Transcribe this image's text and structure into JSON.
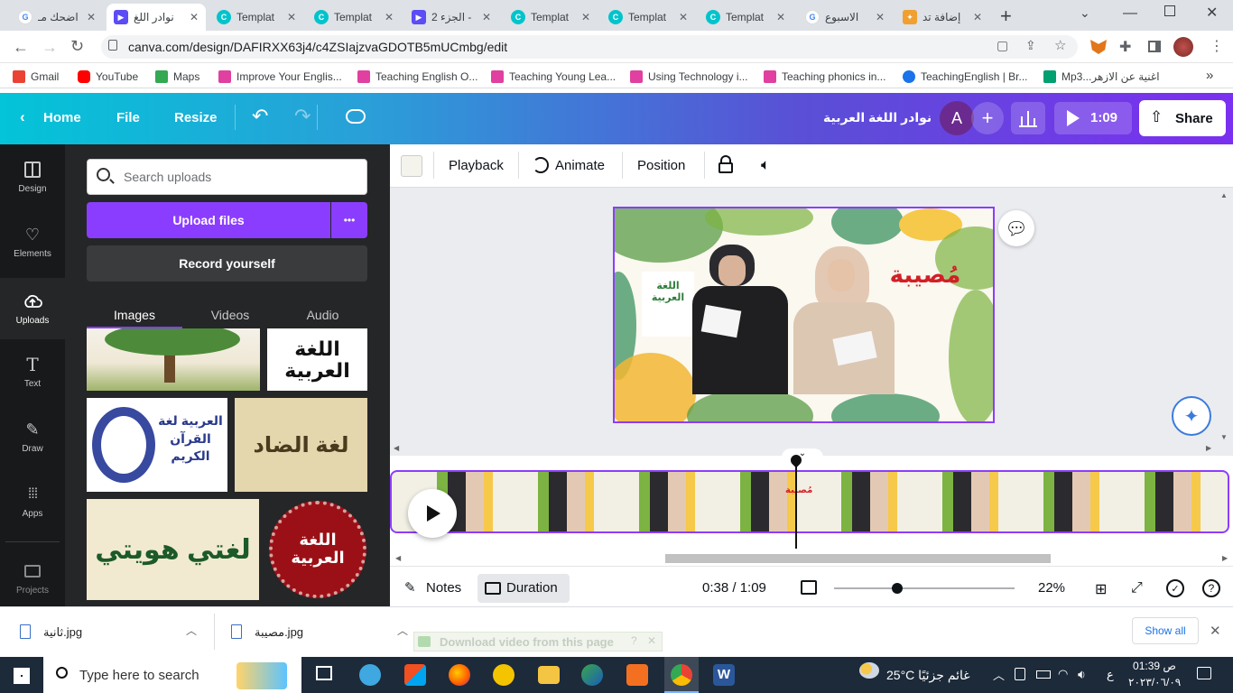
{
  "browser": {
    "tabs": [
      {
        "title": "اضحك مـ",
        "fav": "google-icon",
        "color": "#4285f4"
      },
      {
        "title": "نوادر اللغ",
        "fav": "canva-video-icon",
        "color": "#5b4cf5",
        "active": true
      },
      {
        "title": "Templat",
        "fav": "canva-icon",
        "color": "#00c4cc"
      },
      {
        "title": "Templat",
        "fav": "canva-icon",
        "color": "#00c4cc"
      },
      {
        "title": "الجزء 2 -",
        "fav": "canva-video-icon",
        "color": "#5b4cf5"
      },
      {
        "title": "Templat",
        "fav": "canva-icon",
        "color": "#00c4cc"
      },
      {
        "title": "Templat",
        "fav": "canva-icon",
        "color": "#00c4cc"
      },
      {
        "title": "Templat",
        "fav": "canva-icon",
        "color": "#00c4cc"
      },
      {
        "title": "الاسبوع",
        "fav": "google-icon",
        "color": "#4285f4"
      },
      {
        "title": "إضافة تد",
        "fav": "extension-icon",
        "color": "#f0a030"
      }
    ],
    "new_tab": "+",
    "url": "canva.com/design/DAFIRXX63j4/c4ZSIajzvaGDOTB5mUCmbg/edit",
    "bookmarks": [
      {
        "label": "Gmail",
        "color": "#ea4335"
      },
      {
        "label": "YouTube",
        "color": "#ff0000"
      },
      {
        "label": "Maps",
        "color": "#34a853"
      },
      {
        "label": "Improve Your Englis...",
        "color": "#e040a0"
      },
      {
        "label": "Teaching English O...",
        "color": "#e040a0"
      },
      {
        "label": "Teaching Young Lea...",
        "color": "#e040a0"
      },
      {
        "label": "Using Technology i...",
        "color": "#e040a0"
      },
      {
        "label": "Teaching phonics in...",
        "color": "#e040a0"
      },
      {
        "label": "TeachingEnglish | Br...",
        "color": "#1a73e8"
      },
      {
        "label": "Mp3...اغنية عن الازهر",
        "color": "#00a070"
      }
    ],
    "more_bookmarks": "»"
  },
  "canva_header": {
    "home": "Home",
    "file": "File",
    "resize": "Resize",
    "design_title": "نوادر اللغة العربية",
    "avatar_letter": "A",
    "play_time": "1:09",
    "share": "Share"
  },
  "rail": [
    {
      "label": "Design",
      "icon": "layout-icon"
    },
    {
      "label": "Elements",
      "icon": "shapes-icon"
    },
    {
      "label": "Uploads",
      "icon": "cloud-upload-icon",
      "selected": true
    },
    {
      "label": "Text",
      "icon": "text-icon"
    },
    {
      "label": "Draw",
      "icon": "pen-icon"
    },
    {
      "label": "Apps",
      "icon": "grid-icon"
    },
    {
      "label": "Projects",
      "icon": "folder-icon"
    }
  ],
  "panel": {
    "search_placeholder": "Search uploads",
    "upload_button": "Upload files",
    "more": "•••",
    "record": "Record yourself",
    "tabs": [
      "Images",
      "Videos",
      "Audio"
    ],
    "thumbs": [
      {
        "label": "",
        "type": "tree"
      },
      {
        "label": "اللغة العربية",
        "type": "text-white"
      },
      {
        "label": "العربية لغة القرآن الكريم",
        "type": "text-blue"
      },
      {
        "label": "لغة الضاد",
        "type": "text-tan"
      },
      {
        "label": "لغتي هويتي",
        "type": "text-green"
      },
      {
        "label": "اللغة العربية",
        "type": "seal"
      }
    ]
  },
  "context_bar": {
    "playback": "Playback",
    "animate": "Animate",
    "position": "Position"
  },
  "slide": {
    "title_word": "مُصيبة",
    "logo_text": "اللغة العربية"
  },
  "timeline": {
    "marker_label": "مُصيبة"
  },
  "bottom_bar": {
    "notes": "Notes",
    "duration": "Duration",
    "time": "0:38 / 1:09",
    "zoom": "22%",
    "zoom_fraction": 0.35
  },
  "downloads": [
    {
      "name": "ثانية.jpg"
    },
    {
      "name": "مصيبة.jpg"
    }
  ],
  "download_hint": "Download video from this page",
  "show_all": "Show all",
  "taskbar": {
    "search_placeholder": "Type here to search",
    "weather": "25°C  غائم جزئيًا",
    "time": "01:39 ص",
    "date": "٢٠٢٣/٠٦/٠٩"
  },
  "colors": {
    "canva_purple": "#8b3dff",
    "teal": "#03c4d8"
  }
}
